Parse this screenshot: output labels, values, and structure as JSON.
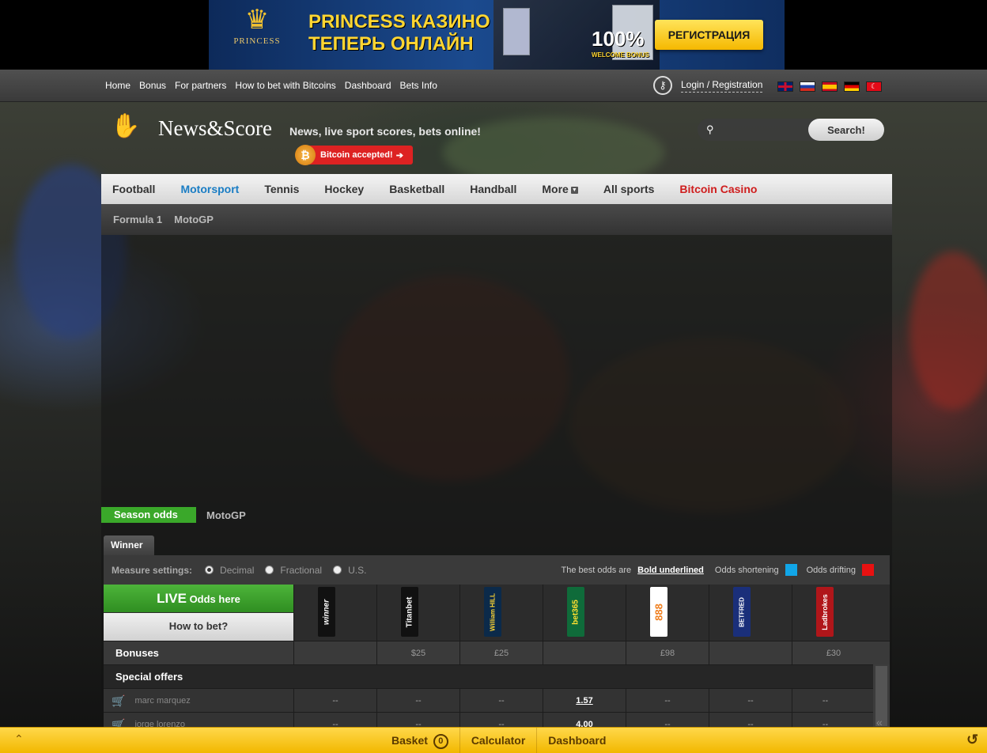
{
  "ad": {
    "brand": "PRINCESS",
    "brand_sub": "CASINO ONLINE",
    "title_line1": "PRINCESS КАЗИНО",
    "title_line2": "ТЕПЕРЬ ОНЛАЙН",
    "bonus": "100%",
    "bonus_sub": "WELCOME BONUS",
    "button": "РЕГИСТРАЦИЯ"
  },
  "topnav": {
    "links": [
      "Home",
      "Bonus",
      "For partners",
      "How to bet with Bitcoins",
      "Dashboard",
      "Bets Info"
    ],
    "login": "Login / Registration",
    "flags": [
      "uk-flag",
      "russia-flag",
      "spain-flag",
      "germany-flag",
      "turkey-flag"
    ]
  },
  "header": {
    "logo": "News&Score",
    "tagline": "News, live sport scores, bets online!",
    "bitcoin": "Bitcoin accepted!",
    "search_button": "Search!",
    "search_placeholder": ""
  },
  "mainnav": {
    "items": [
      "Football",
      "Motorsport",
      "Tennis",
      "Hockey",
      "Basketball",
      "Handball",
      "More",
      "All sports",
      "Bitcoin Casino"
    ],
    "active": "Motorsport"
  },
  "subnav": {
    "items": [
      "Formula 1",
      "MotoGP"
    ]
  },
  "season": {
    "tab": "Season odds",
    "label": "MotoGP",
    "winner_tab": "Winner"
  },
  "measure": {
    "label": "Measure settings:",
    "options": [
      "Decimal",
      "Fractional",
      "U.S."
    ],
    "selected": "Decimal",
    "legend_text": "The best odds are",
    "legend_bold": "Bold underlined",
    "shortening": "Odds shortening",
    "drifting": "Odds drifting",
    "shortening_color": "#11a6e8",
    "drifting_color": "#e81111"
  },
  "odds": {
    "live_big": "LIVE",
    "live_small": "Odds here",
    "how_to": "How to bet?",
    "bookmakers": [
      {
        "name": "winner",
        "bg": "#111111",
        "fg": "#ffffff"
      },
      {
        "name": "Titanbet",
        "bg": "#111111",
        "fg": "#ffffff"
      },
      {
        "name": "William HILL",
        "bg": "#0b2a4a",
        "fg": "#ffd632"
      },
      {
        "name": "bet365",
        "bg": "#0f6b3a",
        "fg": "#ffe030"
      },
      {
        "name": "888",
        "bg": "#ffffff",
        "fg": "#f08020"
      },
      {
        "name": "BETFRED",
        "bg": "#1a2f7a",
        "fg": "#ffffff"
      },
      {
        "name": "Ladbrokes",
        "bg": "#b0161a",
        "fg": "#ffffff"
      }
    ],
    "bonuses_label": "Bonuses",
    "bonuses": [
      "",
      "$25",
      "£25",
      "",
      "£98",
      "",
      "£30"
    ],
    "special_label": "Special offers",
    "runners": [
      {
        "name": "marc marquez",
        "odds": [
          "--",
          "--",
          "--",
          "1.57",
          "--",
          "--",
          "--"
        ],
        "best": 3
      },
      {
        "name": "jorge lorenzo",
        "odds": [
          "--",
          "--",
          "--",
          "4.00",
          "--",
          "--",
          "--"
        ],
        "best": 3
      }
    ]
  },
  "bottombar": {
    "basket": "Basket",
    "basket_count": "0",
    "calculator": "Calculator",
    "dashboard": "Dashboard"
  }
}
